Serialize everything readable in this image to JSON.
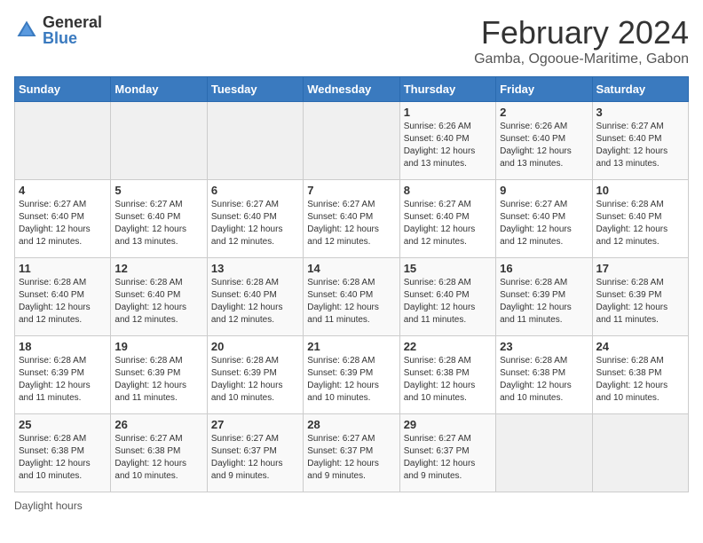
{
  "logo": {
    "general": "General",
    "blue": "Blue"
  },
  "title": "February 2024",
  "subtitle": "Gamba, Ogooue-Maritime, Gabon",
  "days_of_week": [
    "Sunday",
    "Monday",
    "Tuesday",
    "Wednesday",
    "Thursday",
    "Friday",
    "Saturday"
  ],
  "footer": "Daylight hours",
  "weeks": [
    [
      {
        "day": "",
        "info": ""
      },
      {
        "day": "",
        "info": ""
      },
      {
        "day": "",
        "info": ""
      },
      {
        "day": "",
        "info": ""
      },
      {
        "day": "1",
        "info": "Sunrise: 6:26 AM\nSunset: 6:40 PM\nDaylight: 12 hours and 13 minutes."
      },
      {
        "day": "2",
        "info": "Sunrise: 6:26 AM\nSunset: 6:40 PM\nDaylight: 12 hours and 13 minutes."
      },
      {
        "day": "3",
        "info": "Sunrise: 6:27 AM\nSunset: 6:40 PM\nDaylight: 12 hours and 13 minutes."
      }
    ],
    [
      {
        "day": "4",
        "info": "Sunrise: 6:27 AM\nSunset: 6:40 PM\nDaylight: 12 hours and 12 minutes."
      },
      {
        "day": "5",
        "info": "Sunrise: 6:27 AM\nSunset: 6:40 PM\nDaylight: 12 hours and 13 minutes."
      },
      {
        "day": "6",
        "info": "Sunrise: 6:27 AM\nSunset: 6:40 PM\nDaylight: 12 hours and 12 minutes."
      },
      {
        "day": "7",
        "info": "Sunrise: 6:27 AM\nSunset: 6:40 PM\nDaylight: 12 hours and 12 minutes."
      },
      {
        "day": "8",
        "info": "Sunrise: 6:27 AM\nSunset: 6:40 PM\nDaylight: 12 hours and 12 minutes."
      },
      {
        "day": "9",
        "info": "Sunrise: 6:27 AM\nSunset: 6:40 PM\nDaylight: 12 hours and 12 minutes."
      },
      {
        "day": "10",
        "info": "Sunrise: 6:28 AM\nSunset: 6:40 PM\nDaylight: 12 hours and 12 minutes."
      }
    ],
    [
      {
        "day": "11",
        "info": "Sunrise: 6:28 AM\nSunset: 6:40 PM\nDaylight: 12 hours and 12 minutes."
      },
      {
        "day": "12",
        "info": "Sunrise: 6:28 AM\nSunset: 6:40 PM\nDaylight: 12 hours and 12 minutes."
      },
      {
        "day": "13",
        "info": "Sunrise: 6:28 AM\nSunset: 6:40 PM\nDaylight: 12 hours and 12 minutes."
      },
      {
        "day": "14",
        "info": "Sunrise: 6:28 AM\nSunset: 6:40 PM\nDaylight: 12 hours and 11 minutes."
      },
      {
        "day": "15",
        "info": "Sunrise: 6:28 AM\nSunset: 6:40 PM\nDaylight: 12 hours and 11 minutes."
      },
      {
        "day": "16",
        "info": "Sunrise: 6:28 AM\nSunset: 6:39 PM\nDaylight: 12 hours and 11 minutes."
      },
      {
        "day": "17",
        "info": "Sunrise: 6:28 AM\nSunset: 6:39 PM\nDaylight: 12 hours and 11 minutes."
      }
    ],
    [
      {
        "day": "18",
        "info": "Sunrise: 6:28 AM\nSunset: 6:39 PM\nDaylight: 12 hours and 11 minutes."
      },
      {
        "day": "19",
        "info": "Sunrise: 6:28 AM\nSunset: 6:39 PM\nDaylight: 12 hours and 11 minutes."
      },
      {
        "day": "20",
        "info": "Sunrise: 6:28 AM\nSunset: 6:39 PM\nDaylight: 12 hours and 10 minutes."
      },
      {
        "day": "21",
        "info": "Sunrise: 6:28 AM\nSunset: 6:39 PM\nDaylight: 12 hours and 10 minutes."
      },
      {
        "day": "22",
        "info": "Sunrise: 6:28 AM\nSunset: 6:38 PM\nDaylight: 12 hours and 10 minutes."
      },
      {
        "day": "23",
        "info": "Sunrise: 6:28 AM\nSunset: 6:38 PM\nDaylight: 12 hours and 10 minutes."
      },
      {
        "day": "24",
        "info": "Sunrise: 6:28 AM\nSunset: 6:38 PM\nDaylight: 12 hours and 10 minutes."
      }
    ],
    [
      {
        "day": "25",
        "info": "Sunrise: 6:28 AM\nSunset: 6:38 PM\nDaylight: 12 hours and 10 minutes."
      },
      {
        "day": "26",
        "info": "Sunrise: 6:27 AM\nSunset: 6:38 PM\nDaylight: 12 hours and 10 minutes."
      },
      {
        "day": "27",
        "info": "Sunrise: 6:27 AM\nSunset: 6:37 PM\nDaylight: 12 hours and 9 minutes."
      },
      {
        "day": "28",
        "info": "Sunrise: 6:27 AM\nSunset: 6:37 PM\nDaylight: 12 hours and 9 minutes."
      },
      {
        "day": "29",
        "info": "Sunrise: 6:27 AM\nSunset: 6:37 PM\nDaylight: 12 hours and 9 minutes."
      },
      {
        "day": "",
        "info": ""
      },
      {
        "day": "",
        "info": ""
      }
    ]
  ]
}
